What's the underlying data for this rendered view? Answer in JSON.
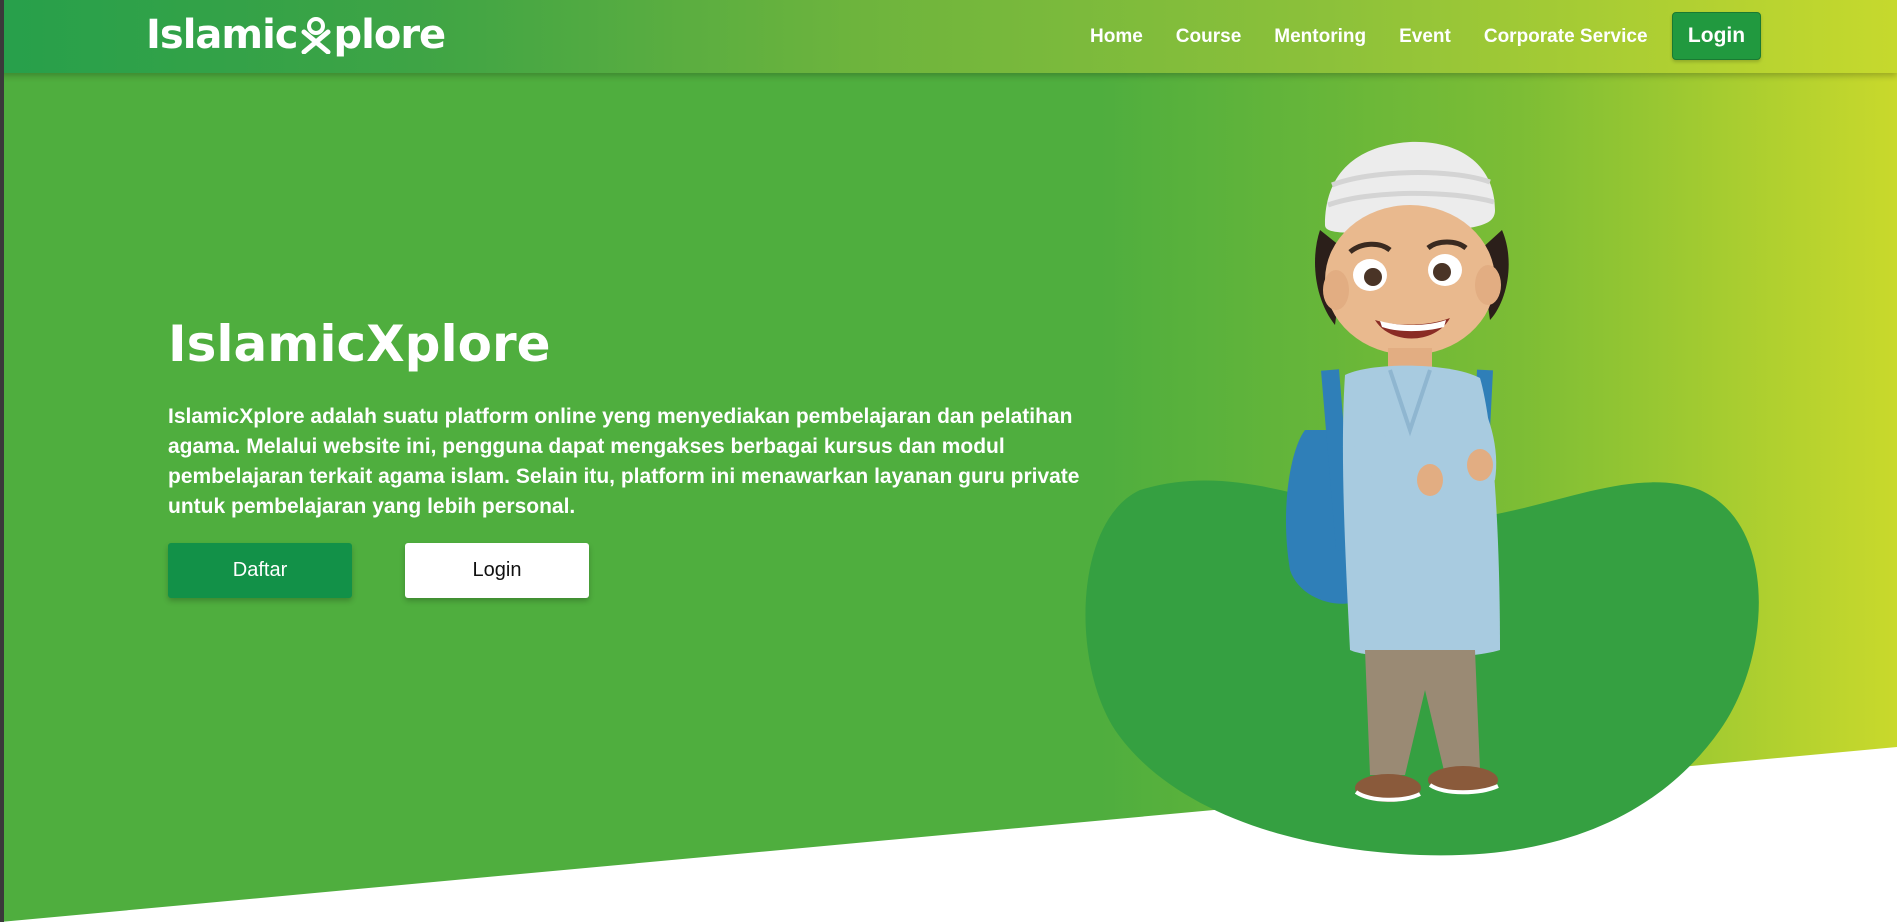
{
  "brand": {
    "logo_text_left": "Islamic",
    "logo_text_right": "plore",
    "logo_mark_icon": "crescent-x-mark-icon"
  },
  "nav": {
    "items": [
      {
        "label": "Home"
      },
      {
        "label": "Course"
      },
      {
        "label": "Mentoring"
      },
      {
        "label": "Event"
      },
      {
        "label": "Corporate Service"
      }
    ],
    "login_label": "Login"
  },
  "hero": {
    "title": "IslamicXplore",
    "description": "IslamicXplore adalah suatu platform online yeng menyediakan pembelajaran dan pelatihan agama. Melalui website ini, pengguna dapat mengakses berbagai kursus dan modul pembelajaran terkait agama islam. Selain itu, platform ini menawarkan layanan guru private untuk pembelajaran yang lebih personal.",
    "daftar_label": "Daftar",
    "login_label": "Login",
    "illustration": "student-boy-with-backpack-illustration"
  },
  "colors": {
    "hero_green": "#4fae3e",
    "hero_lime": "#c9d92c",
    "blob_green": "#35a041",
    "daftar_button": "#129148",
    "nav_login_button": "#21993f"
  }
}
